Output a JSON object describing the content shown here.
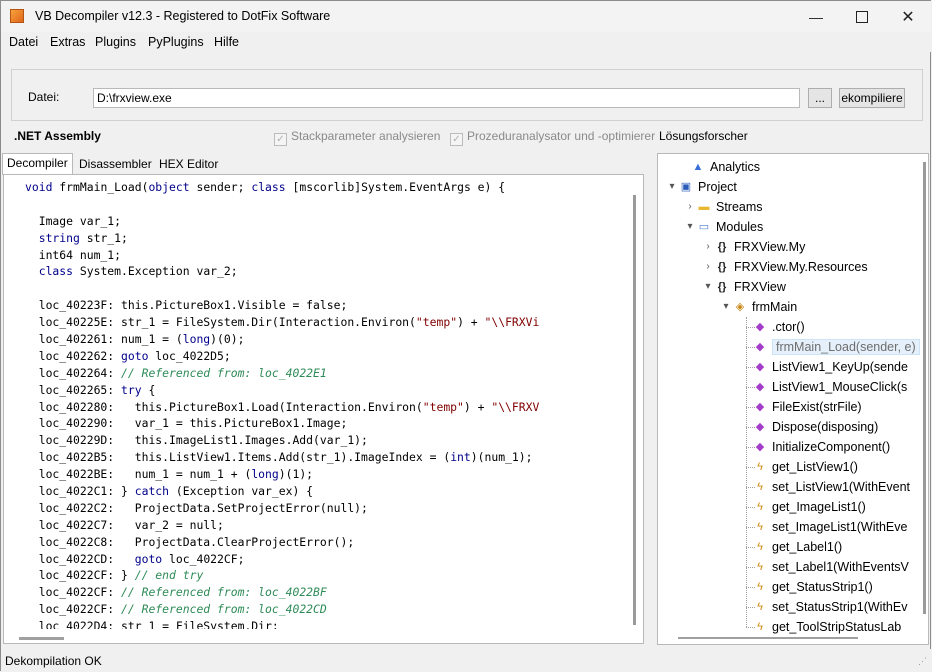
{
  "window": {
    "title": "VB Decompiler v12.3 - Registered to DotFix Software"
  },
  "menu": [
    "Datei",
    "Extras",
    "Plugins",
    "PyPlugins",
    "Hilfe"
  ],
  "file": {
    "label": "Datei:",
    "path": "D:\\frxview.exe",
    "browse_label": "...",
    "decompile_label": "ekompiliere"
  },
  "assembly_label": ".NET Assembly",
  "options": {
    "stack_params": "Stackparameter analysieren",
    "proc_analyzer": "Prozeduranalysator und -optimierer",
    "solution_explorer": "Lösungsforscher"
  },
  "tabs": [
    "Decompiler",
    "Disassembler",
    "HEX Editor"
  ],
  "code": [
    [
      {
        "t": "void ",
        "c": "kw"
      },
      {
        "t": "frmMain_Load(",
        "c": ""
      },
      {
        "t": "object",
        "c": "kw"
      },
      {
        "t": " sender; ",
        "c": ""
      },
      {
        "t": "class",
        "c": "kw"
      },
      {
        "t": " [mscorlib]System.EventArgs e) {",
        "c": ""
      }
    ],
    [],
    [
      {
        "t": "  Image var_1;",
        "c": ""
      }
    ],
    [
      {
        "t": "  ",
        "c": ""
      },
      {
        "t": "string",
        "c": "kw"
      },
      {
        "t": " str_1;",
        "c": ""
      }
    ],
    [
      {
        "t": "  int64 num_1;",
        "c": ""
      }
    ],
    [
      {
        "t": "  ",
        "c": ""
      },
      {
        "t": "class",
        "c": "kw"
      },
      {
        "t": " System.Exception var_2;",
        "c": ""
      }
    ],
    [],
    [
      {
        "t": "  loc_40223F: this.PictureBox1.Visible = false;",
        "c": ""
      }
    ],
    [
      {
        "t": "  loc_40225E: str_1 = FileSystem.Dir(Interaction.Environ(",
        "c": ""
      },
      {
        "t": "\"temp\"",
        "c": "str"
      },
      {
        "t": ") + ",
        "c": ""
      },
      {
        "t": "\"\\\\FRXVi",
        "c": "str"
      }
    ],
    [
      {
        "t": "  loc_402261: num_1 = (",
        "c": ""
      },
      {
        "t": "long",
        "c": "kw"
      },
      {
        "t": ")(0);",
        "c": ""
      }
    ],
    [
      {
        "t": "  loc_402262: ",
        "c": ""
      },
      {
        "t": "goto",
        "c": "kw"
      },
      {
        "t": " loc_4022D5;",
        "c": ""
      }
    ],
    [
      {
        "t": "  loc_402264: ",
        "c": ""
      },
      {
        "t": "// Referenced from: loc_4022E1",
        "c": "cm"
      }
    ],
    [
      {
        "t": "  loc_402265: ",
        "c": ""
      },
      {
        "t": "try",
        "c": "kw"
      },
      {
        "t": " {",
        "c": ""
      }
    ],
    [
      {
        "t": "  loc_402280:   this.PictureBox1.Load(Interaction.Environ(",
        "c": ""
      },
      {
        "t": "\"temp\"",
        "c": "str"
      },
      {
        "t": ") + ",
        "c": ""
      },
      {
        "t": "\"\\\\FRXV",
        "c": "str"
      }
    ],
    [
      {
        "t": "  loc_402290:   var_1 = this.PictureBox1.Image;",
        "c": ""
      }
    ],
    [
      {
        "t": "  loc_40229D:   this.ImageList1.Images.Add(var_1);",
        "c": ""
      }
    ],
    [
      {
        "t": "  loc_4022B5:   this.ListView1.Items.Add(str_1).ImageIndex = (",
        "c": ""
      },
      {
        "t": "int",
        "c": "kw"
      },
      {
        "t": ")(num_1);",
        "c": ""
      }
    ],
    [
      {
        "t": "  loc_4022BE:   num_1 = num_1 + (",
        "c": ""
      },
      {
        "t": "long",
        "c": "kw"
      },
      {
        "t": ")(1);",
        "c": ""
      }
    ],
    [
      {
        "t": "  loc_4022C1: } ",
        "c": ""
      },
      {
        "t": "catch",
        "c": "kw"
      },
      {
        "t": " (Exception var_ex) {",
        "c": ""
      }
    ],
    [
      {
        "t": "  loc_4022C2:   ProjectData.SetProjectError(null);",
        "c": ""
      }
    ],
    [
      {
        "t": "  loc_4022C7:   var_2 = null;",
        "c": ""
      }
    ],
    [
      {
        "t": "  loc_4022C8:   ProjectData.ClearProjectError();",
        "c": ""
      }
    ],
    [
      {
        "t": "  loc_4022CD:   ",
        "c": ""
      },
      {
        "t": "goto",
        "c": "kw"
      },
      {
        "t": " loc_4022CF;",
        "c": ""
      }
    ],
    [
      {
        "t": "  loc_4022CF: } ",
        "c": ""
      },
      {
        "t": "// end try",
        "c": "cm"
      }
    ],
    [
      {
        "t": "  loc_4022CF: ",
        "c": ""
      },
      {
        "t": "// Referenced from: loc_4022BF",
        "c": "cm"
      }
    ],
    [
      {
        "t": "  loc_4022CF: ",
        "c": ""
      },
      {
        "t": "// Referenced from: loc_4022CD",
        "c": "cm"
      }
    ],
    [
      {
        "t": "  loc_4022D4: str_1 = FileSystem.Dir;",
        "c": ""
      }
    ]
  ],
  "tree": [
    {
      "label": "Analytics",
      "icon": "analytics-icon",
      "glyph": "▲",
      "color": "#3a6fd8",
      "exp": ""
    },
    {
      "label": "Project",
      "icon": "project-icon",
      "glyph": "▣",
      "color": "#2a5bb8",
      "exp": "▾"
    },
    {
      "label": "Streams",
      "icon": "folder-icon",
      "glyph": "▬",
      "color": "#e8b830",
      "exp": "›"
    },
    {
      "label": "Modules",
      "icon": "modules-icon",
      "glyph": "▭",
      "color": "#4a7ac8",
      "exp": "▾"
    },
    {
      "label": "FRXView.My",
      "icon": "namespace-icon",
      "glyph": "{}",
      "color": "#222",
      "exp": "›"
    },
    {
      "label": "FRXView.My.Resources",
      "icon": "namespace-icon",
      "glyph": "{}",
      "color": "#222",
      "exp": "›"
    },
    {
      "label": "FRXView",
      "icon": "namespace-icon",
      "glyph": "{}",
      "color": "#222",
      "exp": "▾"
    },
    {
      "label": "frmMain",
      "icon": "class-icon",
      "glyph": "◈",
      "color": "#c9881a",
      "exp": "▾"
    },
    {
      "label": ".ctor()",
      "icon": "method-icon",
      "glyph": "◆",
      "color": "#a23bc9",
      "exp": ""
    },
    {
      "label": "frmMain_Load(sender, e)",
      "icon": "method-icon",
      "glyph": "◆",
      "color": "#a23bc9",
      "exp": "",
      "selected": true
    },
    {
      "label": "ListView1_KeyUp(sende",
      "icon": "method-icon",
      "glyph": "◆",
      "color": "#a23bc9",
      "exp": ""
    },
    {
      "label": "ListView1_MouseClick(s",
      "icon": "method-icon",
      "glyph": "◆",
      "color": "#a23bc9",
      "exp": ""
    },
    {
      "label": "FileExist(strFile)",
      "icon": "method-icon",
      "glyph": "◆",
      "color": "#a23bc9",
      "exp": ""
    },
    {
      "label": "Dispose(disposing)",
      "icon": "method-icon",
      "glyph": "◆",
      "color": "#a23bc9",
      "exp": ""
    },
    {
      "label": "InitializeComponent()",
      "icon": "method-icon",
      "glyph": "◆",
      "color": "#a23bc9",
      "exp": ""
    },
    {
      "label": "get_ListView1()",
      "icon": "property-icon",
      "glyph": "ϟ",
      "color": "#d68a12",
      "exp": ""
    },
    {
      "label": "set_ListView1(WithEvent",
      "icon": "property-icon",
      "glyph": "ϟ",
      "color": "#d68a12",
      "exp": ""
    },
    {
      "label": "get_ImageList1()",
      "icon": "property-icon",
      "glyph": "ϟ",
      "color": "#d68a12",
      "exp": ""
    },
    {
      "label": "set_ImageList1(WithEve",
      "icon": "property-icon",
      "glyph": "ϟ",
      "color": "#d68a12",
      "exp": ""
    },
    {
      "label": "get_Label1()",
      "icon": "property-icon",
      "glyph": "ϟ",
      "color": "#d68a12",
      "exp": ""
    },
    {
      "label": "set_Label1(WithEventsV",
      "icon": "property-icon",
      "glyph": "ϟ",
      "color": "#d68a12",
      "exp": ""
    },
    {
      "label": "get_StatusStrip1()",
      "icon": "property-icon",
      "glyph": "ϟ",
      "color": "#d68a12",
      "exp": ""
    },
    {
      "label": "set_StatusStrip1(WithEv",
      "icon": "property-icon",
      "glyph": "ϟ",
      "color": "#d68a12",
      "exp": ""
    },
    {
      "label": "get_ToolStripStatusLab",
      "icon": "property-icon",
      "glyph": "ϟ",
      "color": "#d68a12",
      "exp": ""
    }
  ],
  "status": "Dekompilation OK"
}
